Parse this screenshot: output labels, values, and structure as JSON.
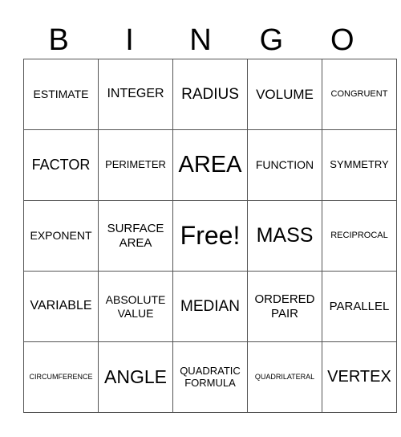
{
  "header": [
    "B",
    "I",
    "N",
    "G",
    "O"
  ],
  "rows": [
    [
      "ESTIMATE",
      "INTEGER",
      "RADIUS",
      "VOLUME",
      "CONGRUENT"
    ],
    [
      "FACTOR",
      "PERIMETER",
      "AREA",
      "FUNCTION",
      "SYMMETRY"
    ],
    [
      "EXPONENT",
      "SURFACE AREA",
      "Free!",
      "MASS",
      "RECIPROCAL"
    ],
    [
      "VARIABLE",
      "ABSOLUTE VALUE",
      "MEDIAN",
      "ORDERED PAIR",
      "PARALLEL"
    ],
    [
      "CIRCUMFERENCE",
      "ANGLE",
      "QUADRATIC FORMULA",
      "QUADRILATERAL",
      "VERTEX"
    ]
  ]
}
